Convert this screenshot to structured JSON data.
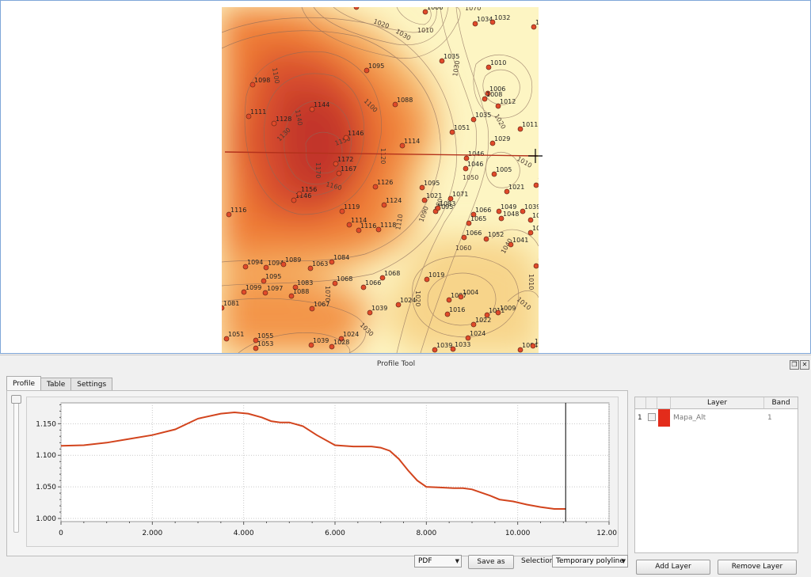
{
  "colors": {
    "accent_profile": "#d2441d",
    "layer_swatch": "#e32c1b",
    "map_high": "#c2362a",
    "map_low": "#fdf5c3"
  },
  "map": {
    "contour_labels": [
      "1100",
      "1140",
      "1130",
      "1150",
      "1120",
      "1170",
      "1160",
      "1100",
      "1020",
      "1030",
      "1010",
      "1030",
      "1020",
      "1010",
      "1050",
      "1060",
      "1070",
      "1080",
      "1090",
      "1110",
      "1040",
      "1010",
      "1010",
      "1020",
      "1030",
      "1070"
    ],
    "points": [
      {
        "label": "1012"
      },
      {
        "label": "1006"
      },
      {
        "label": "1034"
      },
      {
        "label": "1032"
      },
      {
        "label": "1018"
      },
      {
        "label": "1035"
      },
      {
        "label": "1010"
      },
      {
        "label": "1006"
      },
      {
        "label": "1008"
      },
      {
        "label": "1012"
      },
      {
        "label": "1035"
      },
      {
        "label": "1011"
      },
      {
        "label": "1051"
      },
      {
        "label": "1029"
      },
      {
        "label": "1098"
      },
      {
        "label": "1095"
      },
      {
        "label": "1088"
      },
      {
        "label": "1111"
      },
      {
        "label": "1128"
      },
      {
        "label": "1144"
      },
      {
        "label": "1146"
      },
      {
        "label": "1114"
      },
      {
        "label": "1172"
      },
      {
        "label": "1167"
      },
      {
        "label": "1046"
      },
      {
        "label": "1046"
      },
      {
        "label": "1005"
      },
      {
        "label": "1014"
      },
      {
        "label": "1021"
      },
      {
        "label": "1146"
      },
      {
        "label": "1156"
      },
      {
        "label": "1126"
      },
      {
        "label": "1095"
      },
      {
        "label": "1021"
      },
      {
        "label": "1071"
      },
      {
        "label": "1124"
      },
      {
        "label": "1095"
      },
      {
        "label": "1083"
      },
      {
        "label": "1116"
      },
      {
        "label": "1119"
      },
      {
        "label": "1114"
      },
      {
        "label": "1116"
      },
      {
        "label": "1118"
      },
      {
        "label": "1066"
      },
      {
        "label": "1065"
      },
      {
        "label": "1049"
      },
      {
        "label": "1039"
      },
      {
        "label": "1048"
      },
      {
        "label": "1036"
      },
      {
        "label": "1039"
      },
      {
        "label": "1066"
      },
      {
        "label": "1052"
      },
      {
        "label": "1041"
      },
      {
        "label": "1094"
      },
      {
        "label": "1094"
      },
      {
        "label": "1089"
      },
      {
        "label": "1063"
      },
      {
        "label": "1084"
      },
      {
        "label": "1009"
      },
      {
        "label": "1095"
      },
      {
        "label": "1083"
      },
      {
        "label": "1068"
      },
      {
        "label": "1066"
      },
      {
        "label": "1068"
      },
      {
        "label": "1019"
      },
      {
        "label": "1099"
      },
      {
        "label": "1097"
      },
      {
        "label": "1088"
      },
      {
        "label": "1007"
      },
      {
        "label": "1004"
      },
      {
        "label": "1081"
      },
      {
        "label": "1067"
      },
      {
        "label": "1039"
      },
      {
        "label": "1024"
      },
      {
        "label": "1016"
      },
      {
        "label": "1011"
      },
      {
        "label": "1009"
      },
      {
        "label": "1022"
      },
      {
        "label": "1051"
      },
      {
        "label": "1055"
      },
      {
        "label": "1024"
      },
      {
        "label": "1024"
      },
      {
        "label": "1053"
      },
      {
        "label": "1039"
      },
      {
        "label": "1028"
      },
      {
        "label": "1039"
      },
      {
        "label": "1033"
      },
      {
        "label": "1004"
      },
      {
        "label": "1007"
      }
    ]
  },
  "panel": {
    "title": "Profile Tool",
    "restore_icon": "restore-icon",
    "close_icon": "close-icon"
  },
  "tabs": [
    {
      "label": "Profile"
    },
    {
      "label": "Table"
    },
    {
      "label": "Settings"
    }
  ],
  "chart_data": {
    "type": "line",
    "x_ticks": [
      "0",
      "2.000",
      "4.000",
      "6.000",
      "8.000",
      "10.000",
      "12.000"
    ],
    "y_ticks": [
      "1.000",
      "1.050",
      "1.100",
      "1.150"
    ],
    "xlim": [
      0,
      12000
    ],
    "ylim": [
      995,
      1183
    ],
    "grid": true,
    "marker_x": 11050,
    "series": [
      {
        "color": "#d2441d",
        "x": [
          0,
          500,
          1000,
          1500,
          2000,
          2500,
          3000,
          3500,
          3800,
          4100,
          4400,
          4600,
          4800,
          5000,
          5300,
          5600,
          6000,
          6400,
          6800,
          7000,
          7200,
          7400,
          7600,
          7800,
          8000,
          8300,
          8600,
          8800,
          9000,
          9200,
          9400,
          9600,
          9900,
          10200,
          10500,
          10800,
          11050
        ],
        "y": [
          1115,
          1116,
          1120,
          1126,
          1132,
          1141,
          1158,
          1166,
          1168,
          1166,
          1160,
          1154,
          1152,
          1152,
          1146,
          1132,
          1116,
          1114,
          1114,
          1112,
          1107,
          1094,
          1076,
          1060,
          1050,
          1049,
          1048,
          1048,
          1046,
          1041,
          1036,
          1030,
          1027,
          1022,
          1018,
          1015,
          1015
        ]
      }
    ]
  },
  "controls": {
    "format": "PDF",
    "save_as": "Save as",
    "selection_label": "Selection",
    "selection_value": "Temporary polyline",
    "add_layer": "Add Layer",
    "remove_layer": "Remove Layer"
  },
  "layers_table": {
    "headers": {
      "layer": "Layer",
      "band": "Band"
    },
    "rows": [
      {
        "index": "1",
        "name": "Mapa_Alt",
        "band": "1"
      }
    ]
  }
}
